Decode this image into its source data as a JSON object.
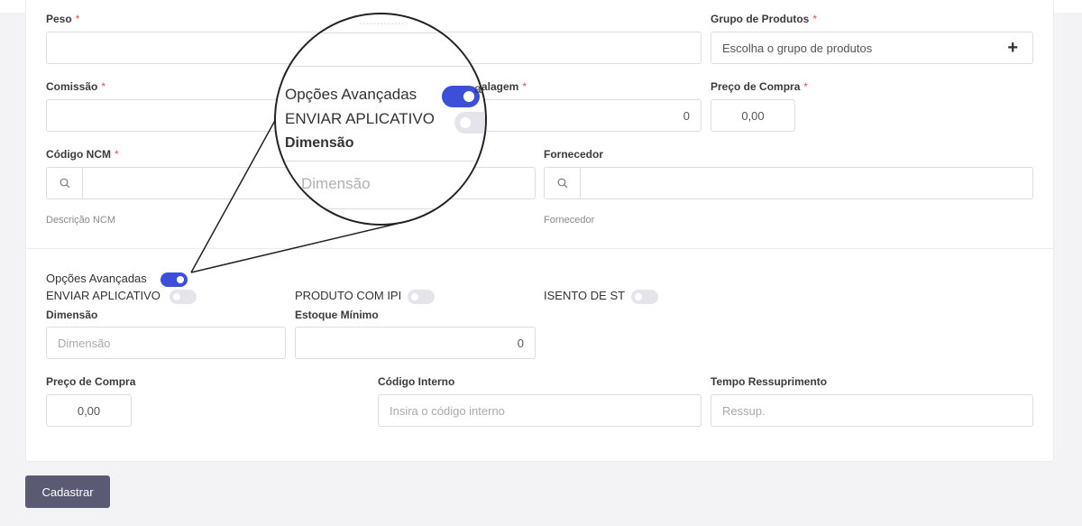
{
  "form": {
    "peso": {
      "label": "Peso",
      "required": "*"
    },
    "grupo_produtos": {
      "label": "Grupo de Produtos",
      "required": "*",
      "placeholder": "Escolha o grupo de produtos",
      "add_icon": "plus-icon"
    },
    "comissao": {
      "label": "Comissão",
      "required": "*"
    },
    "embalagem": {
      "label_partial": "alagem",
      "required": "*",
      "value": "0"
    },
    "preco_compra_top": {
      "label": "Preço de Compra",
      "required": "*",
      "value": "0,00"
    },
    "codigo_ncm": {
      "label": "Código NCM",
      "required": "*",
      "hint": "Descrição NCM",
      "icon": "search-icon"
    },
    "fornecedor": {
      "label": "Fornecedor",
      "hint": "Fornecedor",
      "icon": "search-icon"
    },
    "opcoes_avancadas": {
      "label": "Opções Avançadas",
      "on": true
    },
    "enviar_aplicativo": {
      "label": "ENVIAR APLICATIVO",
      "on": false
    },
    "produto_com_ipi": {
      "label": "PRODUTO COM IPI",
      "on": false
    },
    "isento_st": {
      "label": "ISENTO DE ST",
      "on": false
    },
    "dimensao": {
      "label": "Dimensão",
      "placeholder": "Dimensão"
    },
    "estoque_minimo": {
      "label": "Estoque Mínimo",
      "value": "0"
    },
    "preco_compra": {
      "label": "Preço de Compra",
      "value": "0,00"
    },
    "codigo_interno": {
      "label": "Código Interno",
      "placeholder": "Insira o código interno"
    },
    "tempo_ressuprimento": {
      "label": "Tempo Ressuprimento",
      "placeholder": "Ressup."
    },
    "submit_label": "Cadastrar"
  },
  "zoom": {
    "opcoes_label": "Opções Avançadas",
    "enviar_label": "ENVIAR APLICATIVO",
    "dimensao_label": "Dimensão",
    "dimensao_placeholder": "Dimensão",
    "embalagem_partial": "alagem",
    "required": "*",
    "value_zero": "0"
  },
  "colors": {
    "accent": "#3b4fd8",
    "button": "#5a5a72",
    "required": "#e05050"
  }
}
